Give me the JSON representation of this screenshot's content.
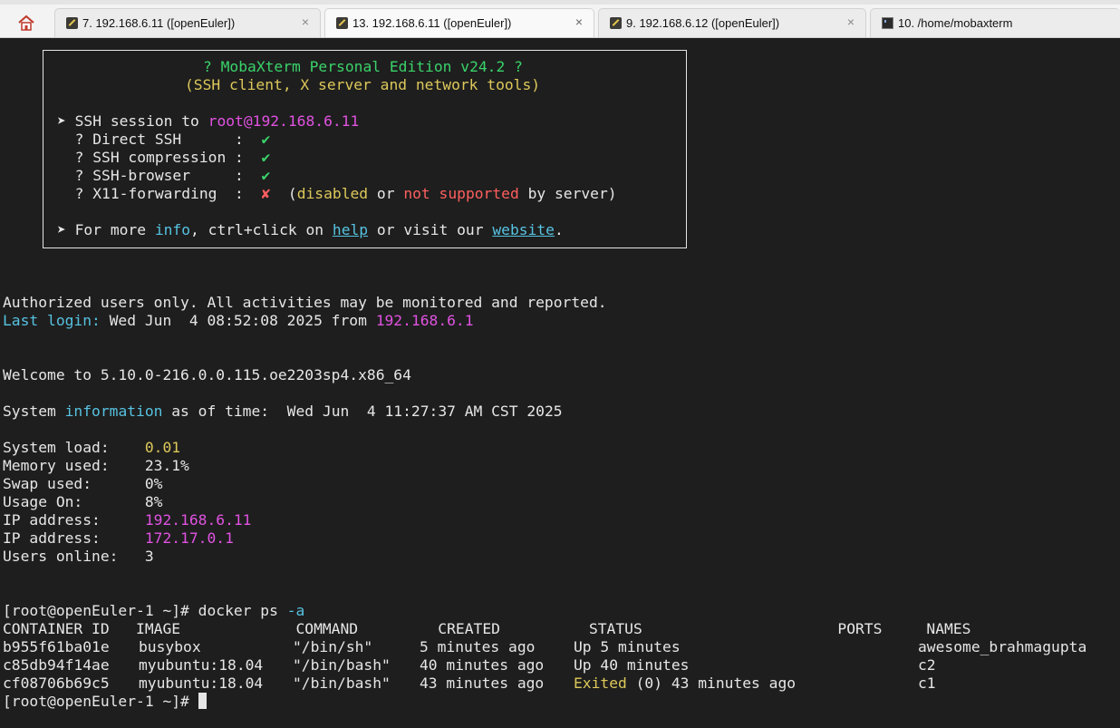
{
  "tabs": [
    {
      "label": "7. 192.168.6.11 ([openEuler])",
      "icon": "ssh-icon",
      "closable": true
    },
    {
      "label": "13. 192.168.6.11 ([openEuler])",
      "icon": "ssh-icon",
      "closable": true,
      "active": true
    },
    {
      "label": "9. 192.168.6.12 ([openEuler])",
      "icon": "ssh-icon",
      "closable": true
    },
    {
      "label": "10. /home/mobaxterm",
      "icon": "terminal-icon",
      "closable": false
    }
  ],
  "close_glyph": "×",
  "banner": {
    "title": "? MobaXterm Personal Edition v24.2 ?",
    "subtitle": "(SSH client, X server and network tools)",
    "session_prefix": "➤ SSH session to ",
    "session_target": "root@192.168.6.11",
    "features": [
      {
        "label": "  ? Direct SSH      :  ",
        "mark": "✔"
      },
      {
        "label": "  ? SSH compression :  ",
        "mark": "✔"
      },
      {
        "label": "  ? SSH-browser     :  ",
        "mark": "✔"
      },
      {
        "label": "  ? X11-forwarding  :  ",
        "mark": "✘"
      }
    ],
    "x11_open": "  (",
    "x11_disabled": "disabled",
    "x11_or": " or ",
    "x11_not_supported": "not supported",
    "x11_tail": " by server)",
    "info_prefix": "➤ For more ",
    "info_word": "info",
    "info_mid": ", ctrl+click on ",
    "help_link": "help",
    "info_mid2": " or visit our ",
    "website_link": "website",
    "info_end": "."
  },
  "authorized": "Authorized users only. All activities may be monitored and reported.",
  "last_login_label": "Last login:",
  "last_login_value": " Wed Jun  4 08:52:08 2025 from ",
  "last_login_ip": "192.168.6.1",
  "welcome": "Welcome to 5.10.0-216.0.0.115.oe2203sp4.x86_64",
  "sysinfo_prefix": "System ",
  "sysinfo_word": "information",
  "sysinfo_suffix": " as of time:  Wed Jun  4 11:27:37 AM CST 2025",
  "stats": [
    {
      "label": "System load:    ",
      "value": "0.01",
      "color": "yel"
    },
    {
      "label": "Memory used:    ",
      "value": "23.1%",
      "color": "wht"
    },
    {
      "label": "Swap used:      ",
      "value": "0%",
      "color": "wht"
    },
    {
      "label": "Usage On:       ",
      "value": "8%",
      "color": "wht"
    },
    {
      "label": "IP address:     ",
      "value": "192.168.6.11",
      "color": "mag"
    },
    {
      "label": "IP address:     ",
      "value": "172.17.0.1",
      "color": "mag"
    },
    {
      "label": "Users online:   ",
      "value": "3",
      "color": "wht"
    }
  ],
  "prompt": "[root@openEuler-1 ~]# ",
  "command": "docker ps ",
  "command_flag": "-a",
  "docker_header": "CONTAINER ID   IMAGE             COMMAND         CREATED          STATUS                      PORTS     NAMES",
  "docker_rows": [
    {
      "id": "b955f61ba01e",
      "image": "busybox",
      "command": "\"/bin/sh\"",
      "created": "5 minutes ago",
      "status_word": "",
      "status": "Up 5 minutes",
      "ports": "",
      "names": "awesome_brahmagupta"
    },
    {
      "id": "c85db94f14ae",
      "image": "myubuntu:18.04",
      "command": "\"/bin/bash\"",
      "created": "40 minutes ago",
      "status_word": "",
      "status": "Up 40 minutes",
      "ports": "",
      "names": "c2"
    },
    {
      "id": "cf08706b69c5",
      "image": "myubuntu:18.04",
      "command": "\"/bin/bash\"",
      "created": "43 minutes ago",
      "status_word": "Exited",
      "status": " (0) 43 minutes ago",
      "ports": "",
      "names": "c1"
    }
  ],
  "colors": {
    "terminal_bg": "#1e1e1e",
    "green": "#3ad36a",
    "yellow": "#ddc85a",
    "magenta": "#e052e0",
    "cyan": "#56c2e0",
    "red": "#ff5f5f"
  }
}
